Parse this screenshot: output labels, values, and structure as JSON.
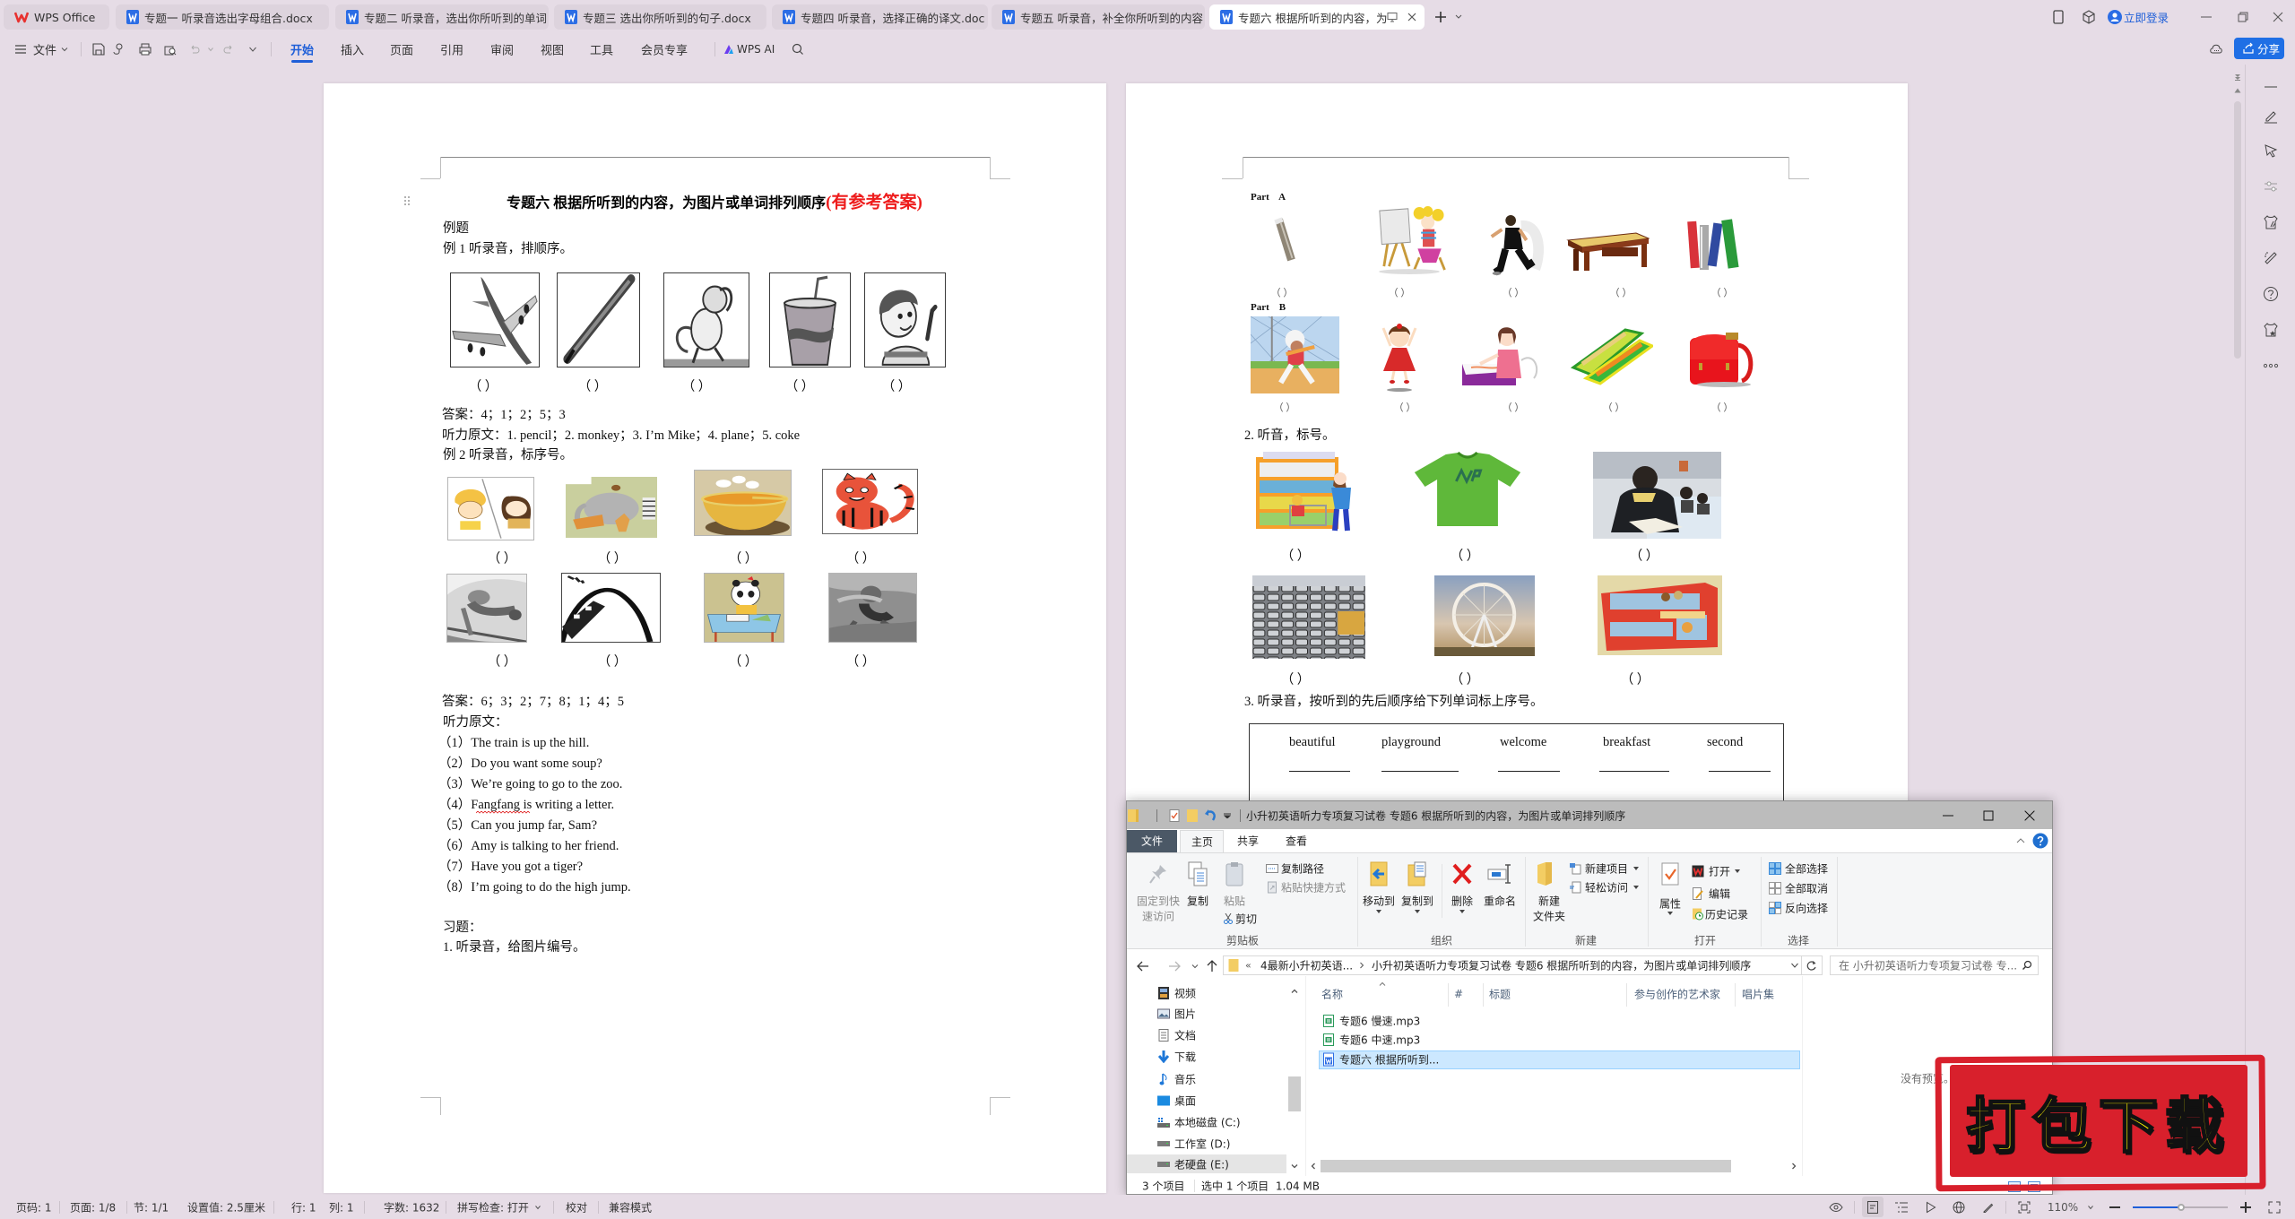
{
  "titlebar": {
    "home_tab": "WPS Office",
    "tabs": [
      {
        "label": "专题一 听录音选出字母组合.docx"
      },
      {
        "label": "专题二 听录音，选出你所听到的单词"
      },
      {
        "label": "专题三 选出你所听到的句子.docx"
      },
      {
        "label": "专题四 听录音，选择正确的译文.doc"
      },
      {
        "label": "专题五 听录音，补全你所听到的内容"
      },
      {
        "label": "专题六 根据所听到的内容，为",
        "active": true
      }
    ],
    "login": "立即登录"
  },
  "toolbar": {
    "file_menu": "文件",
    "tabs": [
      "开始",
      "插入",
      "页面",
      "引用",
      "审阅",
      "视图",
      "工具",
      "会员专享"
    ],
    "active_tab": "开始",
    "ai_label": "WPS AI",
    "share_label": "分享"
  },
  "document": {
    "page1": {
      "title": "专题六  根据所听到的内容，为图片或单词排列顺序",
      "title_note": "(有参考答案)",
      "example_heading": "例题",
      "example1": {
        "instruction": "例 1  听录音，排顺序。",
        "pictures": [
          "plane",
          "pencil",
          "monkey",
          "coke",
          "boy waving"
        ],
        "blank": "（    ）",
        "answer": "答案：4；1；2；5；3",
        "transcript": "听力原文：1. pencil；2. monkey；3. I’m Mike；4. plane；5. coke"
      },
      "example2": {
        "instruction": "例 2  听录音，标序号。",
        "pictures": [
          "talking on the phone",
          "zoo animals",
          "bowl of soup",
          "tiger",
          "climbing",
          "train up the hill",
          "panda writing a letter",
          "high jump"
        ],
        "blank": "（          ）",
        "answer": "答案：6；3；2；7；8；1；4；5",
        "transcript_label": "听力原文：",
        "transcript_lines": [
          "（1）The train is up the hill.",
          "（2）Do you want some soup?",
          "（3）We’re going to go to the zoo.",
          "（4）Fangfang is writing a letter.",
          "（5）Can you jump far, Sam?",
          "（6）Amy is talking to her friend.",
          "（7）Have you got a tiger?",
          "（8）I’m going to do the high jump."
        ]
      },
      "exercises_heading": "习题：",
      "question1": "1. 听录音，给图片编号。"
    },
    "page2": {
      "part_a_label": "Part    A",
      "part_a_pictures": [
        "pencil",
        "girl painting",
        "boy running",
        "desk",
        "books"
      ],
      "part_b_label": "Part    B",
      "part_b_pictures": [
        "playing baseball",
        "girl jumping",
        "girl drawing",
        "pencil case",
        "schoolbag"
      ],
      "blank": "（        ）",
      "question2": "2. 听音，标号。",
      "question2_pictures": [
        "supermarket shopping",
        "green T-shirt",
        "boy reading",
        "traffic jam",
        "ferris wheel",
        "double-decker bus"
      ],
      "question2_blank": "（    ）",
      "question3": "3. 听录音，按听到的先后顺序给下列单词标上序号。",
      "question3_words": [
        "beautiful",
        "playground",
        "welcome",
        "breakfast",
        "second"
      ]
    }
  },
  "explorer": {
    "title": "小升初英语听力专项复习试卷 专题6 根据所听到的内容，为图片或单词排列顺序",
    "ribbon_tabs": [
      "文件",
      "主页",
      "共享",
      "查看"
    ],
    "active_ribbon_tab": "主页",
    "groups": {
      "clipboard": {
        "label": "剪贴板",
        "pin": [
          "固定到快",
          "速访问"
        ],
        "copy": "复制",
        "paste": "粘贴",
        "copy_path": "复制路径",
        "paste_shortcut": "粘贴快捷方式",
        "cut": "剪切"
      },
      "organize": {
        "label": "组织",
        "move_to": "移动到",
        "copy_to": "复制到",
        "delete": "删除",
        "rename": "重命名"
      },
      "new": {
        "label": "新建",
        "new_folder": [
          "新建",
          "文件夹"
        ],
        "new_item": "新建项目",
        "easy_access": "轻松访问"
      },
      "open": {
        "label": "打开",
        "properties": "属性",
        "open": "打开",
        "edit": "编辑",
        "history": "历史记录"
      },
      "select": {
        "label": "选择",
        "select_all": "全部选择",
        "select_none": "全部取消",
        "invert": "反向选择"
      }
    },
    "address_crumbs": [
      "4最新小升初英语...",
      "小升初英语听力专项复习试卷 专题6 根据所听到的内容，为图片或单词排列顺序"
    ],
    "search_placeholder": "在 小升初英语听力专项复习试卷 专...",
    "nav": [
      "视频",
      "图片",
      "文档",
      "下载",
      "音乐",
      "桌面",
      "本地磁盘 (C:)",
      "工作室 (D:)",
      "老硬盘 (E:)"
    ],
    "columns": [
      "名称",
      "#",
      "标题",
      "参与创作的艺术家",
      "唱片集"
    ],
    "files": [
      {
        "name": "专题6 慢速.mp3",
        "type": "audio"
      },
      {
        "name": "专题6 中速.mp3",
        "type": "audio"
      },
      {
        "name": "专题六 根据所听到...",
        "type": "wps-document",
        "selected": true
      }
    ],
    "preview_text": "没有预览。",
    "status": {
      "count": "3 个项目",
      "selection": "选中 1 个项目  1.04 MB"
    }
  },
  "promo_stamp": "打包下载",
  "statusbar": {
    "page_number": "页码: 1",
    "page": "页面: 1/8",
    "section": "节: 1/1",
    "setting": "设置值: 2.5厘米",
    "line": "行: 1",
    "column": "列: 1",
    "word_count": "字数: 1632",
    "spellcheck": "拼写检查: 打开",
    "proofread": "校对",
    "compat_mode": "兼容模式",
    "zoom_label": "110%",
    "zoom_slider_fraction": 0.51
  }
}
